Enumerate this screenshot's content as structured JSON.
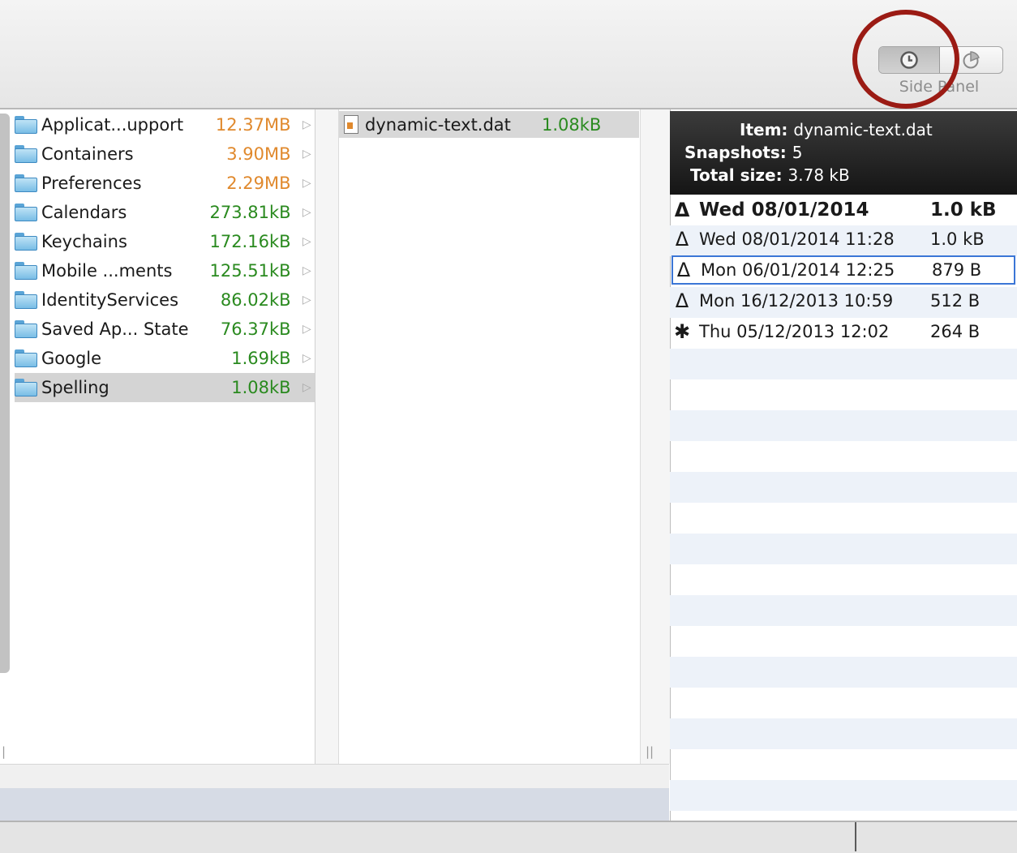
{
  "toolbar": {
    "side_panel_label": "Side Panel",
    "segments": [
      {
        "icon": "clock-icon",
        "selected": true
      },
      {
        "icon": "pie-chart-icon",
        "selected": false
      }
    ],
    "highlight_color": "#9b1b14"
  },
  "column1": {
    "items": [
      {
        "name": "Applicat...upport",
        "size": "12.37MB",
        "color": "orange"
      },
      {
        "name": "Containers",
        "size": "3.90MB",
        "color": "orange"
      },
      {
        "name": "Preferences",
        "size": "2.29MB",
        "color": "orange"
      },
      {
        "name": "Calendars",
        "size": "273.81kB",
        "color": "green"
      },
      {
        "name": "Keychains",
        "size": "172.16kB",
        "color": "green"
      },
      {
        "name": "Mobile ...ments",
        "size": "125.51kB",
        "color": "green"
      },
      {
        "name": "IdentityServices",
        "size": "86.02kB",
        "color": "green"
      },
      {
        "name": "Saved Ap... State",
        "size": "76.37kB",
        "color": "green"
      },
      {
        "name": "Google",
        "size": "1.69kB",
        "color": "green"
      },
      {
        "name": "Spelling",
        "size": "1.08kB",
        "color": "green",
        "selected": true
      }
    ]
  },
  "column2": {
    "file": {
      "name": "dynamic-text.dat",
      "size": "1.08kB"
    }
  },
  "side_panel": {
    "item_label": "Item:",
    "item_value": "dynamic-text.dat",
    "snapshots_label": "Snapshots:",
    "snapshots_value": "5",
    "total_label": "Total size:",
    "total_value": "3.78 kB",
    "snapshots": [
      {
        "icon": "delta-icon",
        "date": "Wed 08/01/2014",
        "size": "1.0  kB",
        "bold": true
      },
      {
        "icon": "delta-icon",
        "date": "Wed 08/01/2014 11:28",
        "size": "1.0  kB"
      },
      {
        "icon": "delta-icon",
        "date": "Mon 06/01/2014 12:25",
        "size": "879  B",
        "focused": true
      },
      {
        "icon": "delta-icon",
        "date": "Mon 16/12/2013 10:59",
        "size": "512  B"
      },
      {
        "icon": "asterisk-icon",
        "date": "Thu 05/12/2013 12:02",
        "size": "264  B"
      }
    ]
  },
  "colors": {
    "size_orange": "#e0892d",
    "size_green": "#2a8a1f",
    "focus_blue": "#3b76d6"
  }
}
